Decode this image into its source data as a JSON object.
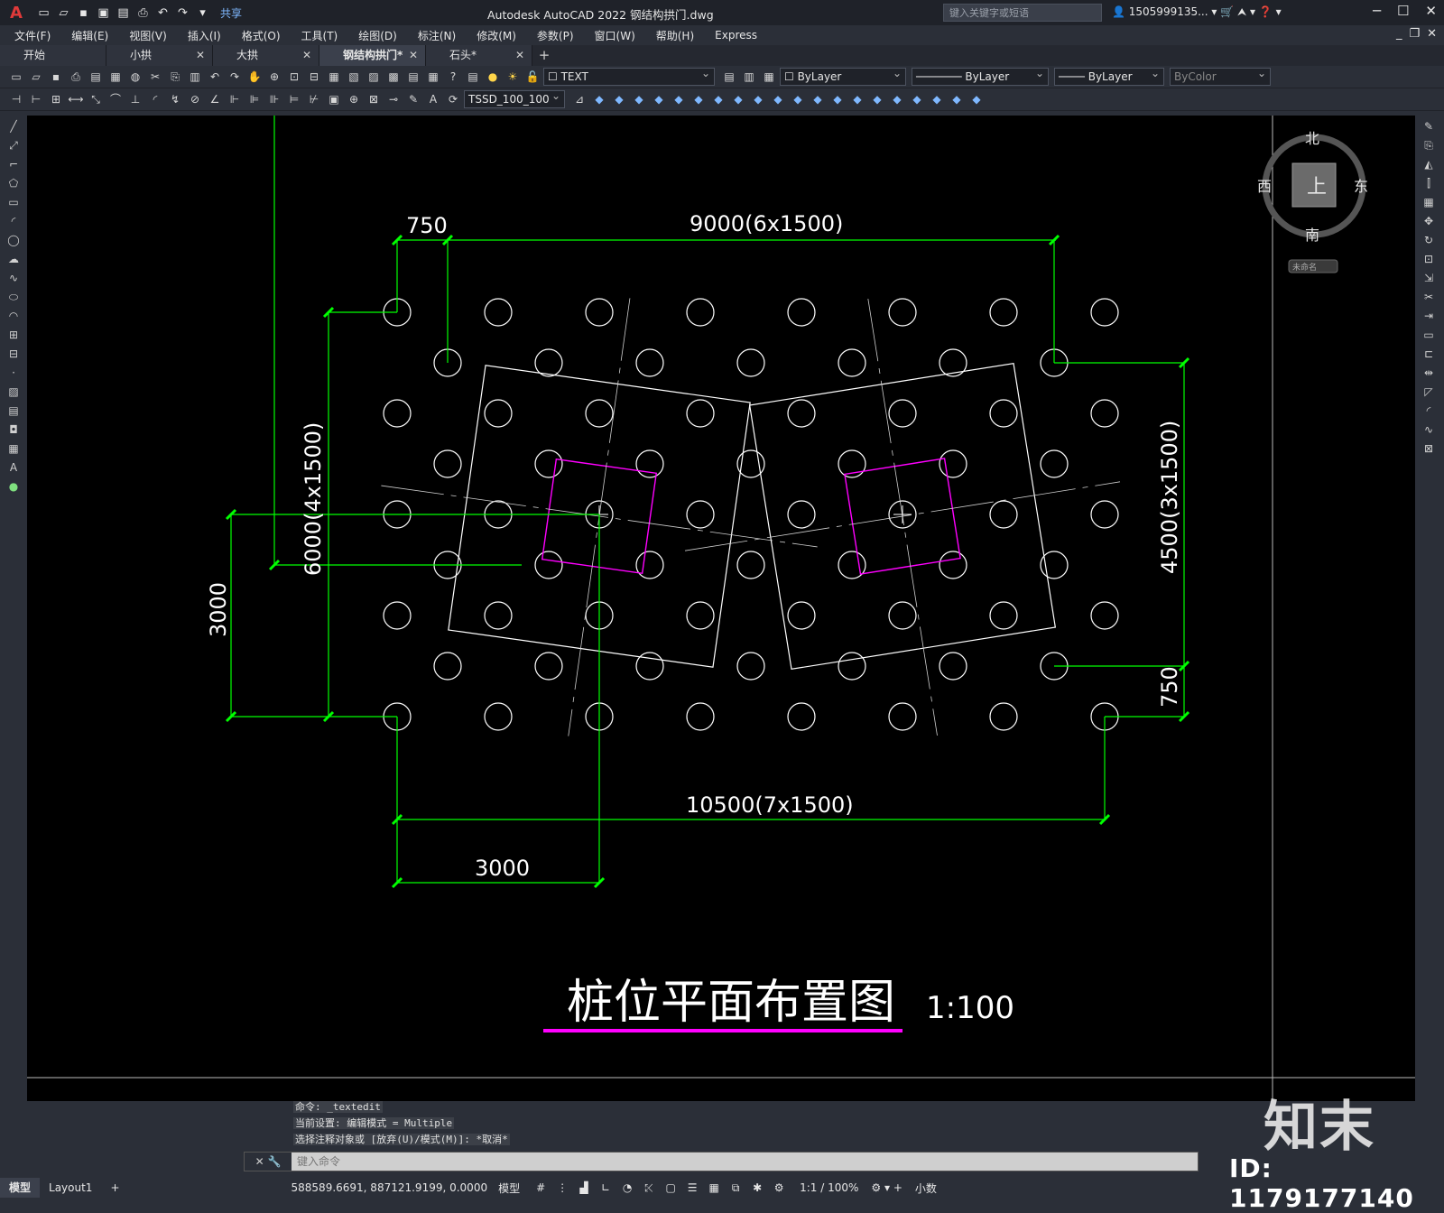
{
  "app": {
    "title": "Autodesk AutoCAD 2022    钢结构拱门.dwg",
    "search_placeholder": "键入关键字或短语",
    "user": "1505999135...",
    "share": "共享",
    "logo": "A"
  },
  "menu": [
    "文件(F)",
    "编辑(E)",
    "视图(V)",
    "插入(I)",
    "格式(O)",
    "工具(T)",
    "绘图(D)",
    "标注(N)",
    "修改(M)",
    "参数(P)",
    "窗口(W)",
    "帮助(H)",
    "Express"
  ],
  "tabs": [
    {
      "label": "开始",
      "active": false,
      "closable": false
    },
    {
      "label": "小拱",
      "active": false,
      "closable": true
    },
    {
      "label": "大拱",
      "active": false,
      "closable": true
    },
    {
      "label": "钢结构拱门*",
      "active": true,
      "closable": true
    },
    {
      "label": "石头*",
      "active": false,
      "closable": true
    }
  ],
  "toolbar1": {
    "layer": "TEXT",
    "color": "ByLayer",
    "linetype": "ByLayer",
    "lineweight": "ByLayer",
    "plotstyle": "ByColor"
  },
  "toolbar2": {
    "dimstyle": "TSSD_100_100"
  },
  "viewcube": {
    "north": "北",
    "south": "南",
    "east": "东",
    "west": "西",
    "face": "上",
    "ucs": "未命名"
  },
  "drawing": {
    "dims": {
      "top_offset": "750",
      "top_span": "9000(6x1500)",
      "left_vertical": "6000(4x1500)",
      "left_short": "3000",
      "right_vertical": "4500(3x1500)",
      "right_short": "750",
      "bottom_span": "10500(7x1500)",
      "bottom_short": "3000"
    },
    "title": "桩位平面布置图",
    "scale": "1:100",
    "colors": {
      "dim": "#00ff00",
      "outline": "#ffffff",
      "inner": "#ff00ff",
      "circle": "#ffffff"
    }
  },
  "command": {
    "history": [
      "命令: _textedit",
      "当前设置: 编辑模式 = Multiple",
      "选择注释对象或 [放弃(U)/模式(M)]: *取消*"
    ],
    "placeholder": "键入命令"
  },
  "status": {
    "model_tab": "模型",
    "layout_tab": "Layout1",
    "coords": "588589.6691, 887121.9199, 0.0000",
    "space": "模型",
    "scale": "1:1 / 100%",
    "units": "小数"
  },
  "watermark": {
    "brand": "知末",
    "id": "ID: 1179177140"
  }
}
